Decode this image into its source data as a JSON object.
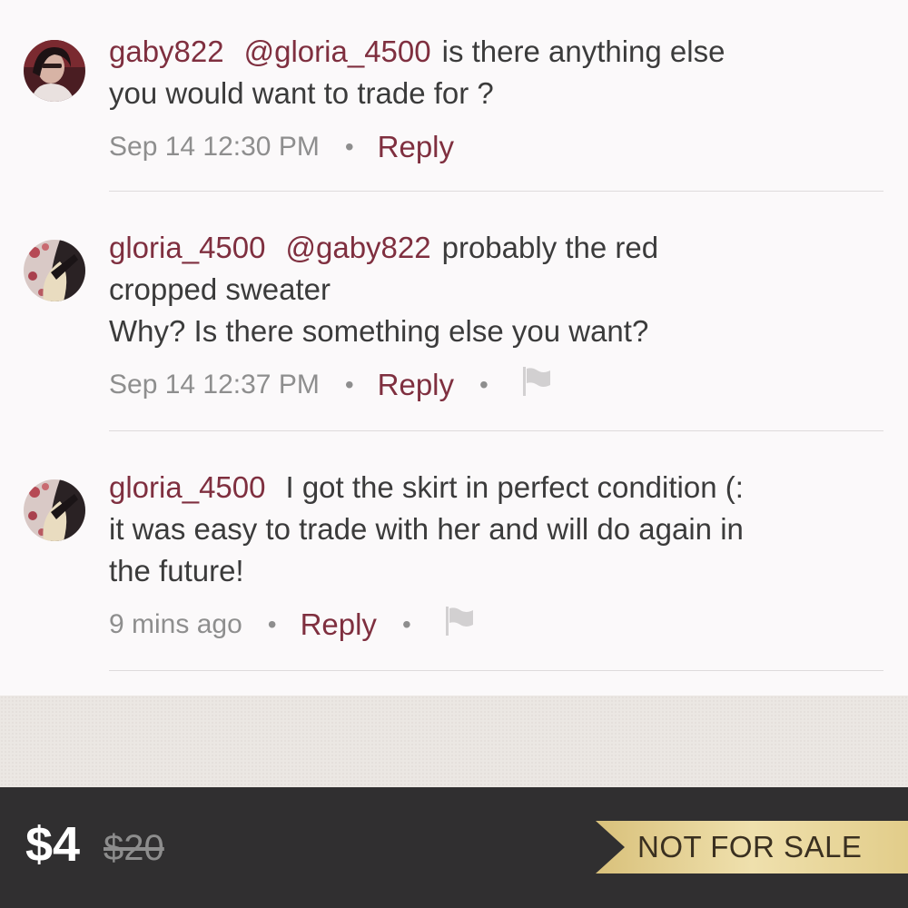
{
  "comments": [
    {
      "username": "gaby822",
      "mention": "@gloria_4500",
      "text_inline": "is there anything else",
      "text_rest": "you would want to trade for ?",
      "text_extra": "",
      "time": "Sep 14 12:30 PM",
      "reply_label": "Reply",
      "has_flag": false
    },
    {
      "username": "gloria_4500",
      "mention": "@gaby822",
      "text_inline": "probably the red",
      "text_rest": "cropped sweater",
      "text_extra": "Why? Is there something else you want?",
      "time": "Sep 14 12:37 PM",
      "reply_label": "Reply",
      "has_flag": true
    },
    {
      "username": "gloria_4500",
      "mention": "",
      "text_inline": "I got the skirt in perfect condition (:",
      "text_rest": "it was easy to trade with her and will do again in",
      "text_extra": "the future!",
      "time": "9 mins ago",
      "reply_label": "Reply",
      "has_flag": true
    }
  ],
  "icons": {
    "flag": "flag-icon",
    "avatar_1": "avatar-gaby822",
    "avatar_2": "avatar-gloria_4500"
  },
  "bottom_bar": {
    "price": "$4",
    "original_price": "$20",
    "status": "NOT FOR SALE"
  },
  "colors": {
    "username": "#7f2f3f",
    "text": "#3b3b3b",
    "muted": "#8e8e8e",
    "bar": "#302f30",
    "banner": "#e8d59a"
  }
}
